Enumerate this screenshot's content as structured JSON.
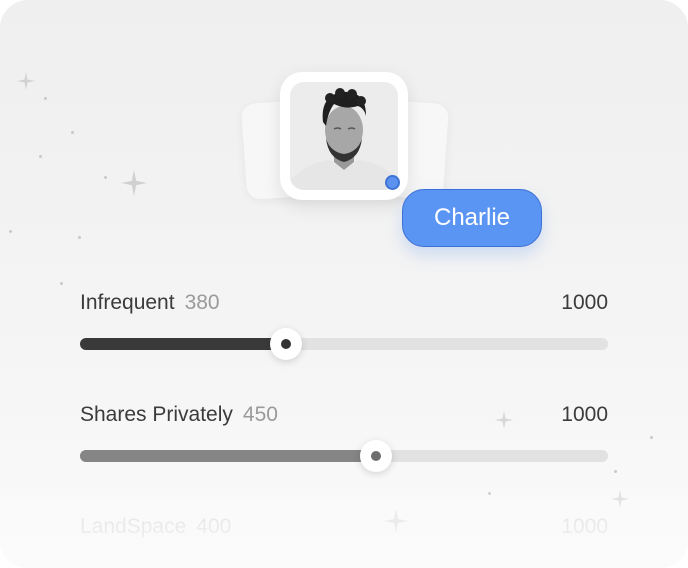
{
  "profile": {
    "name": "Charlie",
    "status_color": "#5b92f0",
    "avatar_icon": "person-portrait-icon"
  },
  "sliders": [
    {
      "label": "Infrequent",
      "value": "380",
      "max": "1000",
      "fraction": 0.39
    },
    {
      "label": "Shares Privately",
      "value": "450",
      "max": "1000",
      "fraction": 0.56
    },
    {
      "label": "LandSpace",
      "value": "400",
      "max": "1000"
    }
  ],
  "colors": {
    "accent": "#5b95f3",
    "slider1_fill": "#3a3a3a",
    "slider2_fill": "#858585",
    "track": "#e2e2e2"
  },
  "decorations": {
    "sparkle_icon": "sparkle-icon"
  }
}
